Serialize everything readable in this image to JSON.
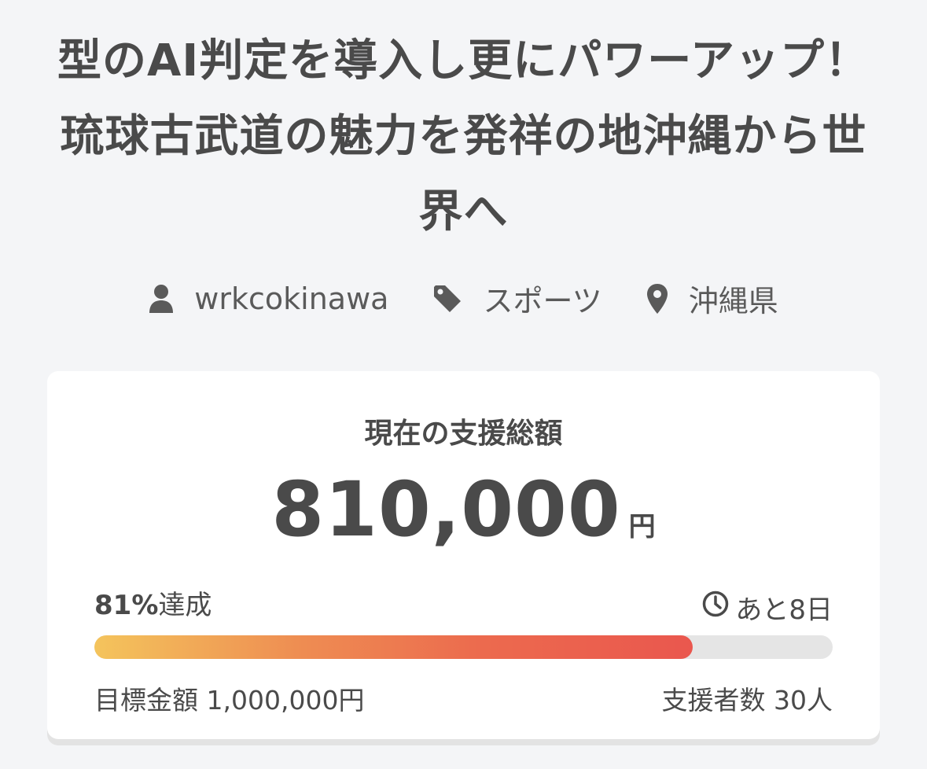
{
  "project": {
    "title": "型のAI判定を導入し更にパワーアップ！琉球古武道の魅力を発祥の地沖縄から世界へ",
    "owner": "wrkcokinawa",
    "category": "スポーツ",
    "location": "沖縄県"
  },
  "funding": {
    "label": "現在の支援総額",
    "amount": "810,000",
    "currency": "円",
    "percent": "81%",
    "percent_suffix": "達成",
    "progress_fraction": 0.81,
    "remaining": "あと8日",
    "goal": "目標金額 1,000,000円",
    "backers": "支援者数 30人"
  },
  "icons": {
    "owner": "user-icon",
    "category": "tag-icon",
    "location": "map-pin-icon",
    "remaining": "clock-icon"
  },
  "colors": {
    "background": "#f4f5f7",
    "text": "#4a4a4a",
    "bar_start": "#f4c45c",
    "bar_end": "#ea574e",
    "bar_track": "#e5e5e5"
  }
}
